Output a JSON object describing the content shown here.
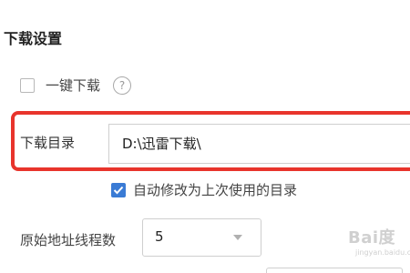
{
  "section": {
    "title": "下载设置"
  },
  "one_click": {
    "label": "一键下载",
    "checked": false,
    "help_glyph": "?",
    "help_icon": "question-circle-icon"
  },
  "download_dir": {
    "label": "下载目录",
    "value": "D:\\迅雷下载\\",
    "highlight_color": "#e8342c"
  },
  "auto_modify": {
    "label": "自动修改为上次使用的目录",
    "checked": true,
    "accent_color": "#3a7bd5"
  },
  "thread_count": {
    "label": "原始地址线程数",
    "value": "5",
    "dropdown_icon": "chevron-down-icon"
  },
  "watermark": {
    "main": "Bai度",
    "sub": "jingyan.baidu.com"
  }
}
